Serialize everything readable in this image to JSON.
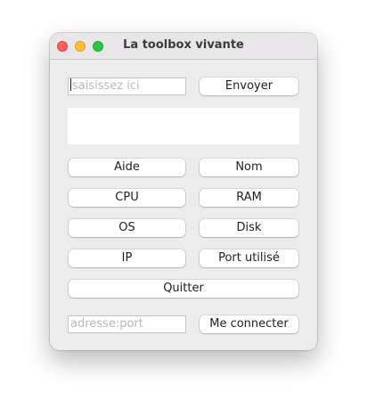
{
  "window": {
    "title": "La toolbox vivante"
  },
  "message": {
    "placeholder": "saisissez ici",
    "send_label": "Envoyer"
  },
  "output": {
    "text": ""
  },
  "buttons": {
    "aide": "Aide",
    "nom": "Nom",
    "cpu": "CPU",
    "ram": "RAM",
    "os": "OS",
    "disk": "Disk",
    "ip": "IP",
    "port": "Port utilisé",
    "quit": "Quitter"
  },
  "connect": {
    "placeholder": "adresse:port",
    "connect_label": "Me connecter"
  }
}
